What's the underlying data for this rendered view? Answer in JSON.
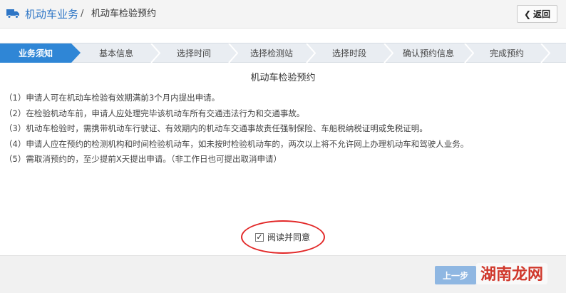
{
  "header": {
    "module_title": "机动车业务",
    "separator": "/",
    "page_title": "机动车检验预约",
    "back_label": "返回",
    "truck_icon": "truck-icon"
  },
  "steps": [
    {
      "label": "业务须知",
      "active": true
    },
    {
      "label": "基本信息",
      "active": false
    },
    {
      "label": "选择时间",
      "active": false
    },
    {
      "label": "选择检测站",
      "active": false
    },
    {
      "label": "选择时段",
      "active": false
    },
    {
      "label": "确认预约信息",
      "active": false
    },
    {
      "label": "完成预约",
      "active": false
    }
  ],
  "content": {
    "title": "机动车检验预约",
    "rules": [
      "（1）申请人可在机动车检验有效期满前3个月内提出申请。",
      "（2）在检验机动车前，申请人应处理完毕该机动车所有交通违法行为和交通事故。",
      "（3）机动车检验时，需携带机动车行驶证、有效期内的机动车交通事故责任强制保险、车船税纳税证明或免税证明。",
      "（4）申请人应在预约的检测机构和时间检验机动车，如未按时检验机动车的，两次以上将不允许网上办理机动车和驾驶人业务。",
      "（5）需取消预约的，至少提前X天提出申请。（非工作日也可提出取消申请）"
    ]
  },
  "agree": {
    "label": "阅读并同意",
    "checked": true
  },
  "footer": {
    "prev_label": "上一步",
    "watermark": "湖南龙网"
  },
  "colors": {
    "accent": "#2f86d6",
    "step_bg": "#e9edf2",
    "highlight_circle": "#e22828",
    "prev_button": "#8fb7e2",
    "watermark": "#d0382c"
  }
}
